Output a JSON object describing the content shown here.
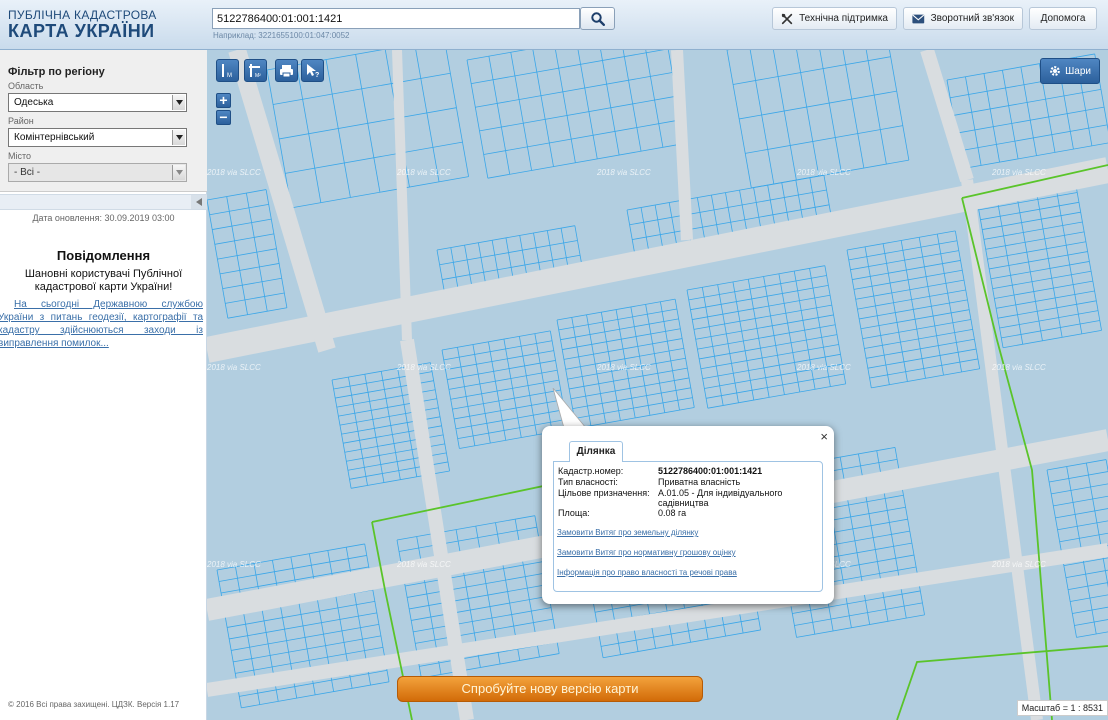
{
  "header": {
    "logo_line1": "ПУБЛІЧНА КАДАСТРОВА",
    "logo_line2": "КАРТА УКРАЇНИ",
    "search_value": "5122786400:01:001:1421",
    "search_hint": "Наприклад: 3221655100:01:047:0052",
    "buttons": {
      "support": "Технічна підтримка",
      "feedback": "Зворотний зв'язок",
      "help": "Допомога"
    }
  },
  "sidebar": {
    "filter_title": "Фільтр по регіону",
    "oblast_label": "Область",
    "oblast_value": "Одеська",
    "raion_label": "Район",
    "raion_value": "Комінтернівський",
    "city_label": "Місто",
    "city_value": "- Всі -",
    "update_date": "Дата оновлення: 30.09.2019 03:00",
    "news_title": "Повідомлення",
    "news_greeting": "Шановні користувачі Публічної кадастрової карти України!",
    "news_body": "На сьогодні Державною службою України з питань геодезії, картографії та кадастру здійснюються заходи із виправлення помилок...",
    "copyright": "© 2016 Всі права захищені. ЦДЗК. Версія 1.17"
  },
  "map": {
    "layers_label": "Шари",
    "zoom_in": "+",
    "zoom_out": "−",
    "watermark": "2018 via SLCC",
    "new_version": "Спробуйте нову версію карти",
    "scale": "Масштаб = 1 : 8531",
    "tools": [
      "distance-tool-icon",
      "area-tool-icon",
      "print-icon",
      "identify-icon"
    ]
  },
  "popup": {
    "tab": "Ділянка",
    "close": "×",
    "rows": [
      {
        "key": "Кадастр.номер:",
        "value": "5122786400:01:001:1421"
      },
      {
        "key": "Тип власності:",
        "value": "Приватна власність"
      },
      {
        "key": "Цільове призначення:",
        "value": "A.01.05 - Для індивідуального садівництва"
      },
      {
        "key": "Площа:",
        "value": "0.08 га"
      }
    ],
    "links": [
      "Замовити Витяг про земельну ділянку",
      "Замовити Витяг про нормативну грошову оцінку",
      "Інформація про право власності та речові права"
    ]
  },
  "colors": {
    "parcel_fill": "#b2cee0",
    "parcel_line": "#3aa6e8",
    "road": "#d9dde0",
    "boundary": "#5ac42a",
    "accent": "#2c609c",
    "orange": "#e8891f"
  }
}
